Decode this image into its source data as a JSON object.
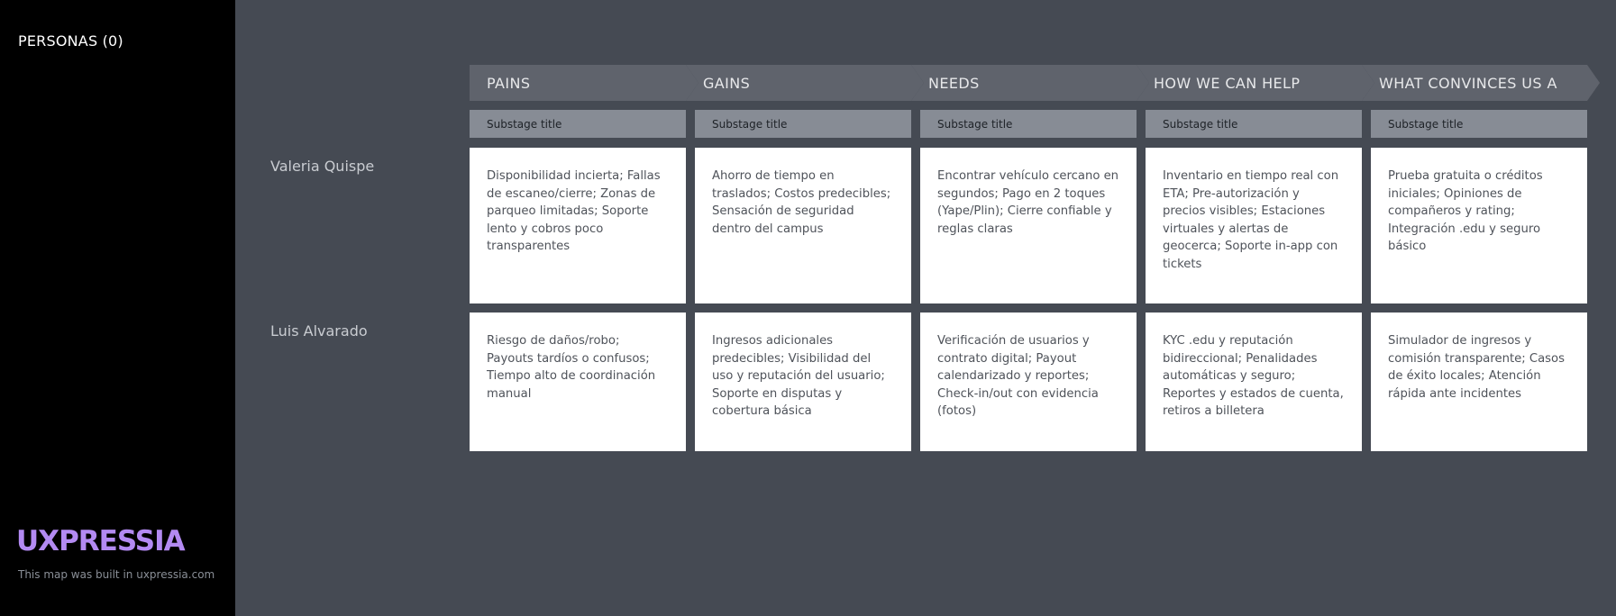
{
  "sidebar": {
    "personas_title": "PERSONAS (0)",
    "logo_text": "UXPRESSIA",
    "footer_note": "This map was built in uxpressia.com"
  },
  "stages": [
    {
      "label": "PAINS",
      "substage": "Substage title"
    },
    {
      "label": "GAINS",
      "substage": "Substage title"
    },
    {
      "label": "NEEDS",
      "substage": "Substage title"
    },
    {
      "label": "HOW WE CAN HELP",
      "substage": "Substage title"
    },
    {
      "label": "WHAT CONVINCES US A",
      "substage": "Substage title"
    }
  ],
  "personas": [
    {
      "name": "Valeria Quispe",
      "cells": [
        "Disponibilidad incierta; Fallas de escaneo/cierre; Zonas de parqueo limitadas; Soporte lento y cobros poco transparentes",
        "Ahorro de tiempo en traslados; Costos predecibles; Sensación de seguridad dentro del campus",
        "Encontrar vehículo cercano en segundos; Pago en 2 toques (Yape/Plin); Cierre confiable y reglas claras",
        "Inventario en tiempo real con ETA; Pre-autorización y precios visibles; Estaciones virtuales y alertas de geocerca; Soporte in-app con tickets",
        "Prueba gratuita o créditos iniciales; Opiniones de compañeros y rating; Integración .edu y seguro básico"
      ]
    },
    {
      "name": "Luis Alvarado",
      "cells": [
        "Riesgo de daños/robo; Payouts tardíos o confusos; Tiempo alto de coordinación manual",
        "Ingresos adicionales predecibles; Visibilidad del uso y reputación del usuario; Soporte en disputas y cobertura básica",
        "Verificación de usuarios y contrato digital; Payout calendarizado y reportes; Check-in/out con evidencia (fotos)",
        "KYC .edu y reputación bidireccional; Penalidades automáticas y seguro; Reportes y estados de cuenta, retiros a billetera",
        "Simulador de ingresos y comisión transparente; Casos de éxito locales; Atención rápida ante incidentes"
      ]
    }
  ],
  "colors": {
    "canvas": "#454a53",
    "sidebar": "#000000",
    "stage": "#5f636c",
    "substage": "#878c95",
    "logo": "#b38af2",
    "card": "#ffffff"
  }
}
